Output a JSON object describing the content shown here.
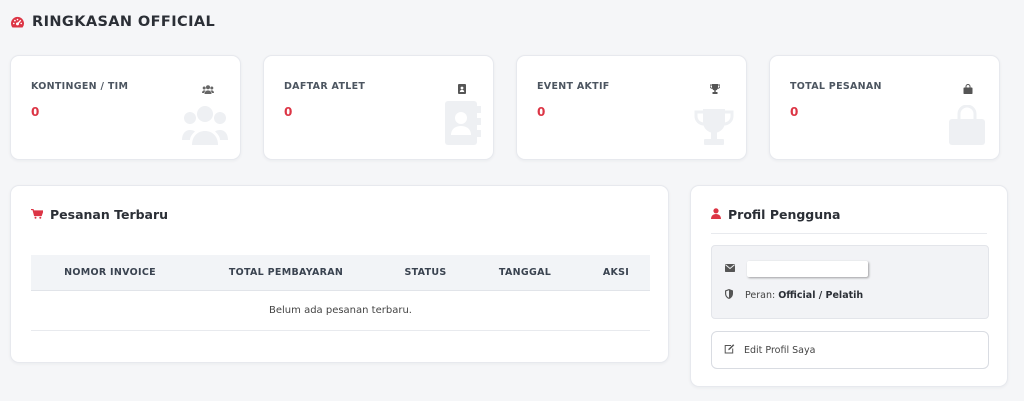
{
  "header": {
    "title": "RINGKASAN OFFICIAL",
    "icon": "dashboard-icon",
    "accent": "#dc3545"
  },
  "stats": [
    {
      "label": "KONTINGEN / TIM",
      "value": "0",
      "icon": "users-icon"
    },
    {
      "label": "DAFTAR ATLET",
      "value": "0",
      "icon": "address-book-icon"
    },
    {
      "label": "EVENT AKTIF",
      "value": "0",
      "icon": "trophy-icon"
    },
    {
      "label": "TOTAL PESANAN",
      "value": "0",
      "icon": "shopping-bag-icon"
    }
  ],
  "orders": {
    "title": "Pesanan Terbaru",
    "icon": "cart-icon",
    "columns": [
      "NOMOR INVOICE",
      "TOTAL PEMBAYARAN",
      "STATUS",
      "TANGGAL",
      "AKSI"
    ],
    "empty_text": "Belum ada pesanan terbaru."
  },
  "profile": {
    "title": "Profil Pengguna",
    "icon": "user-icon",
    "email_icon": "envelope-icon",
    "role_icon": "shield-icon",
    "role_label": "Peran:",
    "role_value": "Official / Pelatih",
    "edit_label": "Edit Profil Saya",
    "edit_icon": "edit-icon"
  }
}
